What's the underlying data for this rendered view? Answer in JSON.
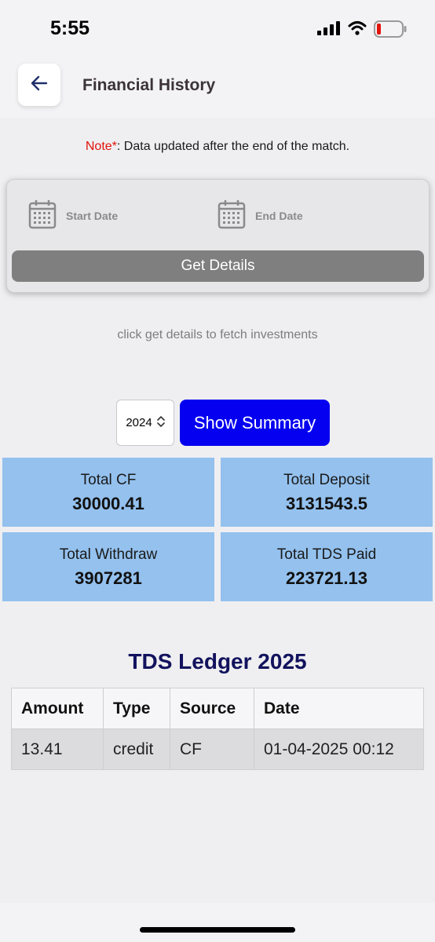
{
  "status_bar": {
    "time": "5:55",
    "icons": [
      "signal-icon",
      "wifi-icon",
      "battery-low-icon"
    ]
  },
  "header": {
    "title": "Financial History",
    "back_icon": "arrow-left-icon"
  },
  "note": {
    "label": "Note*",
    "text": ": Data updated after the end of the match."
  },
  "date_filter": {
    "start_placeholder": "Start Date",
    "end_placeholder": "End Date",
    "calendar_icon": "calendar-icon",
    "button_label": "Get Details"
  },
  "hint": "click get details to fetch investments",
  "summary_controls": {
    "year": "2024",
    "button_label": "Show Summary"
  },
  "stats": [
    {
      "label": "Total CF",
      "value": "30000.41"
    },
    {
      "label": "Total Deposit",
      "value": "3131543.5"
    },
    {
      "label": "Total Withdraw",
      "value": "3907281"
    },
    {
      "label": "Total TDS Paid",
      "value": "223721.13"
    }
  ],
  "ledger": {
    "title": "TDS Ledger 2025",
    "columns": [
      "Amount",
      "Type",
      "Source",
      "Date"
    ],
    "rows": [
      [
        "13.41",
        "credit",
        "CF",
        "01-04-2025 00:12"
      ]
    ]
  },
  "colors": {
    "accent_blue": "#0600f0",
    "stat_background": "#94c1ee",
    "note_red": "#e3120b",
    "ledger_title": "#12125e"
  }
}
